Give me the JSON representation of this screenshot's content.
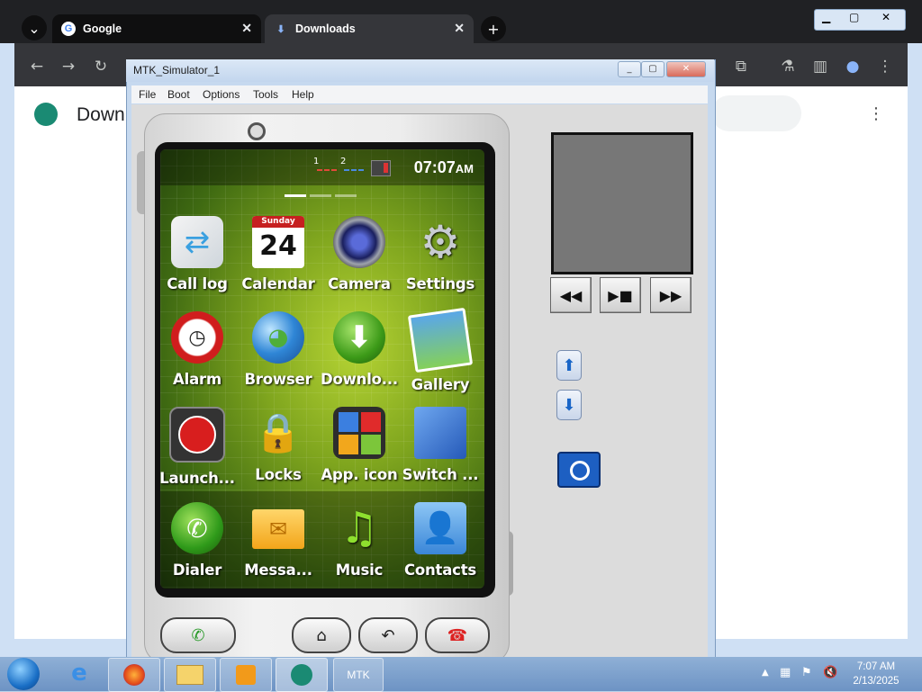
{
  "chrome": {
    "tabs": [
      {
        "label": "Google"
      },
      {
        "label": "Downloads"
      }
    ],
    "page_title": "Down"
  },
  "simulator": {
    "window_title": "MTK_Simulator_1",
    "menu": [
      "File",
      "Boot",
      "Options",
      "Tools",
      "Help"
    ]
  },
  "phone": {
    "clock": "07:07",
    "ampm": "AM",
    "sim_indicators": [
      "1",
      "2"
    ],
    "calendar_day": "Sunday",
    "calendar_date": "24",
    "apps": [
      {
        "label": "Call log",
        "icon": "call-log-icon"
      },
      {
        "label": "Calendar",
        "icon": "calendar-icon"
      },
      {
        "label": "Camera",
        "icon": "camera-icon"
      },
      {
        "label": "Settings",
        "icon": "settings-gear-icon"
      },
      {
        "label": "Alarm",
        "icon": "alarm-clock-icon"
      },
      {
        "label": "Browser",
        "icon": "globe-icon"
      },
      {
        "label": "Downlo...",
        "icon": "download-arrow-icon"
      },
      {
        "label": "Gallery",
        "icon": "gallery-photo-icon"
      },
      {
        "label": "Launch...",
        "icon": "launcher-icon"
      },
      {
        "label": "Locks",
        "icon": "padlock-icon"
      },
      {
        "label": "App. icon",
        "icon": "app-grid-icon"
      },
      {
        "label": "Switch ...",
        "icon": "switch-icon"
      },
      {
        "label": "Dialer",
        "icon": "phone-icon"
      },
      {
        "label": "Messa...",
        "icon": "envelope-icon"
      },
      {
        "label": "Music",
        "icon": "music-note-icon"
      },
      {
        "label": "Contacts",
        "icon": "contact-person-icon"
      }
    ]
  },
  "taskbar": {
    "running_app": "MTK",
    "time": "7:07 AM",
    "date": "2/13/2025"
  },
  "colors": {
    "chrome_dark": "#202124",
    "screen_green": "#7fa51e",
    "taskbar_blue": "#6d93c4"
  }
}
